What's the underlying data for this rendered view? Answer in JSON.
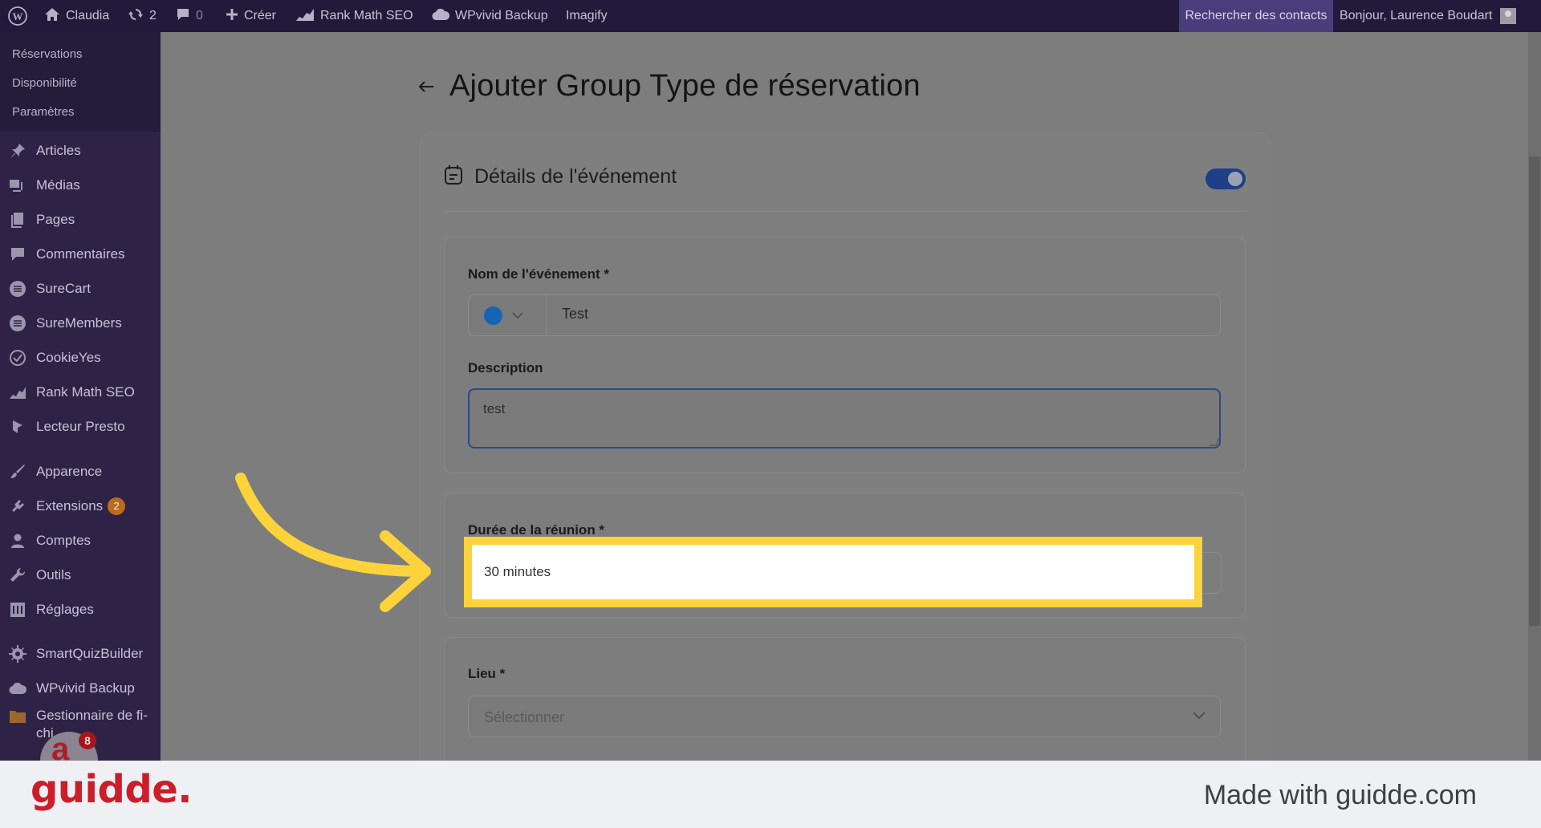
{
  "adminbar": {
    "site_name": "Claudia",
    "updates_count": "2",
    "comments_count": "0",
    "create_label": "Créer",
    "rankmath_label": "Rank Math SEO",
    "wpvivid_label": "WPvivid Backup",
    "imagify_label": "Imagify",
    "search_contacts_label": "Rechercher des contacts",
    "greeting": "Bonjour, Laurence Boudart"
  },
  "sidebar": {
    "submenu": [
      "Réservations",
      "Disponibilité",
      "Paramètres"
    ],
    "items": [
      {
        "label": "Articles",
        "icon": "pin-icon"
      },
      {
        "label": "Médias",
        "icon": "media-icon"
      },
      {
        "label": "Pages",
        "icon": "pages-icon"
      },
      {
        "label": "Commentaires",
        "icon": "comment-icon"
      },
      {
        "label": "SureCart",
        "icon": "surecart-icon"
      },
      {
        "label": "SureMembers",
        "icon": "suremembers-icon"
      },
      {
        "label": "CookieYes",
        "icon": "cookie-icon"
      },
      {
        "label": "Rank Math SEO",
        "icon": "rankmath-icon"
      },
      {
        "label": "Lecteur Presto",
        "icon": "presto-icon"
      },
      {
        "label": "Apparence",
        "icon": "brush-icon"
      },
      {
        "label": "Extensions",
        "icon": "plugin-icon",
        "badge": "2"
      },
      {
        "label": "Comptes",
        "icon": "user-icon"
      },
      {
        "label": "Outils",
        "icon": "wrench-icon"
      },
      {
        "label": "Réglages",
        "icon": "settings-icon"
      },
      {
        "label": "SmartQuizBuilder",
        "icon": "gear-icon"
      },
      {
        "label": "WPvivid Backup",
        "icon": "cloud-icon"
      },
      {
        "label": "Gestionnaire de fi-chi",
        "icon": "folder-icon"
      }
    ],
    "notification_count": "8"
  },
  "page": {
    "title": "Ajouter Group Type de réservation",
    "section_title": "Détails de l'événement",
    "toggle_on": true,
    "event_name_label": "Nom de l'événement *",
    "event_name_value": "Test",
    "event_color": "#1565b5",
    "description_label": "Description",
    "description_value": "test",
    "duration_label": "Durée de la réunion *",
    "duration_value": "30 minutes",
    "location_label": "Lieu *",
    "location_placeholder": "Sélectionner"
  },
  "footer": {
    "brand": "guidde.",
    "made_with": "Made with guidde.com"
  },
  "colors": {
    "highlight": "#fcd33a",
    "brand_red": "#cc1d2a",
    "admin_bar": "#231a3b",
    "toggle": "#1f3f86"
  }
}
